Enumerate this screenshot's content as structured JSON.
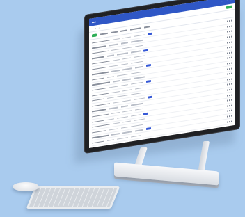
{
  "colors": {
    "background": "#a9cbee",
    "app_header": "#2f57c6",
    "accent_button": "#2eae57",
    "badge": "#3558d6"
  },
  "screen_rows": 22
}
